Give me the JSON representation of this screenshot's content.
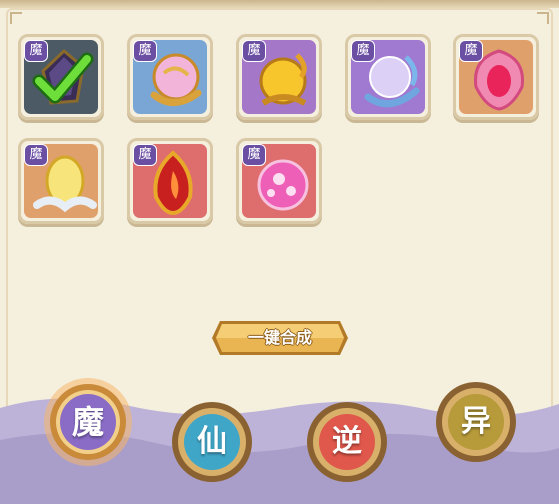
{
  "grid": {
    "items": [
      {
        "tag": "魔",
        "bg": "#4c5a66",
        "selected": true
      },
      {
        "tag": "魔",
        "bg": "#7aa6d6"
      },
      {
        "tag": "魔",
        "bg": "#a577c9"
      },
      {
        "tag": "魔",
        "bg": "#a079d1"
      },
      {
        "tag": "魔",
        "bg": "#e0a06b"
      },
      {
        "tag": "魔",
        "bg": "#e0a06b"
      },
      {
        "tag": "魔",
        "bg": "#de6d6d"
      },
      {
        "tag": "魔",
        "bg": "#de6d6d"
      }
    ]
  },
  "merge_button": {
    "label": "一键合成"
  },
  "tabs": [
    {
      "label": "魔",
      "color": "#8a6cc7",
      "active": true
    },
    {
      "label": "仙",
      "color": "#3fa6c8"
    },
    {
      "label": "逆",
      "color": "#e0574b"
    },
    {
      "label": "异",
      "color": "#b79a3a"
    }
  ]
}
